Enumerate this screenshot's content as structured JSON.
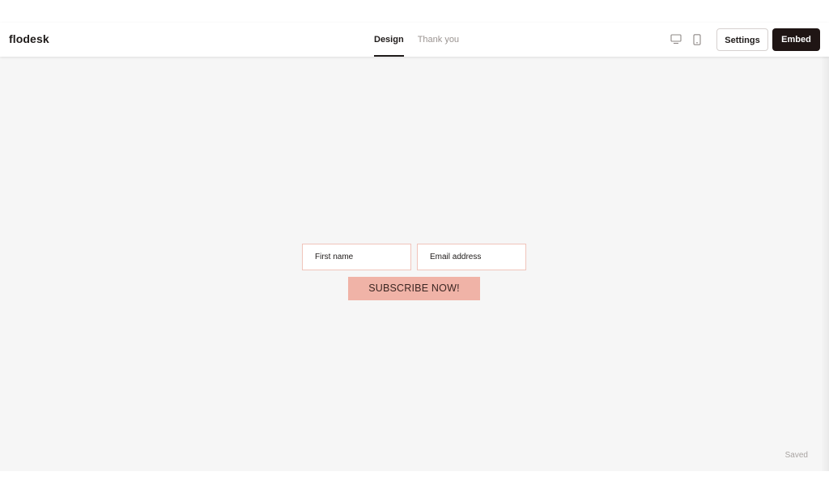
{
  "header": {
    "logo": "flodesk",
    "tabs": [
      {
        "label": "Design",
        "active": true
      },
      {
        "label": "Thank you",
        "active": false
      }
    ],
    "device_icons": [
      "desktop-icon",
      "mobile-icon"
    ],
    "settings_label": "Settings",
    "embed_label": "Embed"
  },
  "form": {
    "first_name_placeholder": "First name",
    "email_placeholder": "Email address",
    "submit_label": "SUBSCRIBE NOW!"
  },
  "status": {
    "saved": "Saved"
  },
  "colors": {
    "accent_button": "#f0b3a7",
    "input_border": "#f0c4bb",
    "embed_button": "#1f1514",
    "canvas_background": "#f6f6f6"
  }
}
